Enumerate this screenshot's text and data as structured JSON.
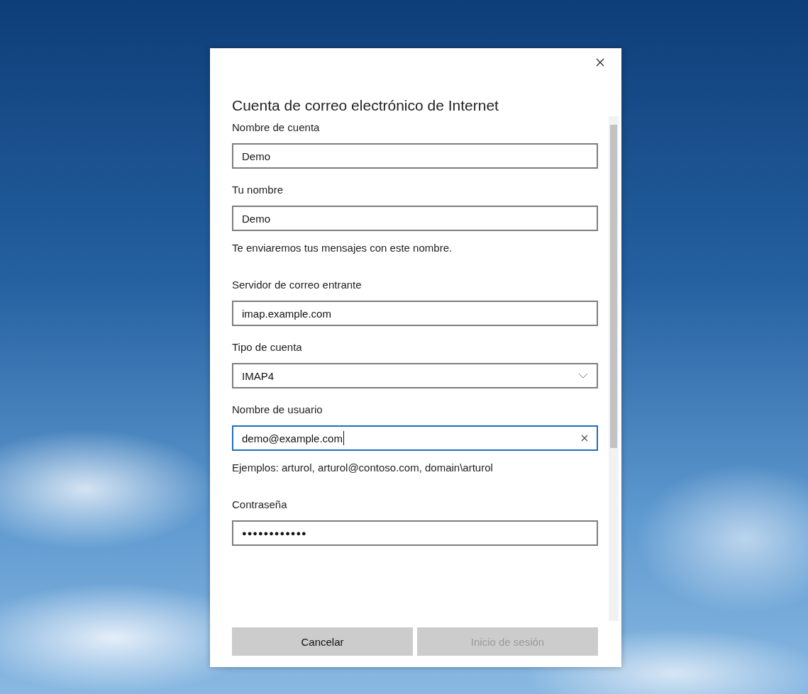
{
  "dialog": {
    "title": "Cuenta de correo electrónico de Internet",
    "fields": [
      {
        "label": "Nombre de cuenta",
        "kind": "text",
        "value": "Demo",
        "focused": false
      },
      {
        "label": "Tu nombre",
        "kind": "text",
        "value": "Demo",
        "focused": false,
        "hint": "Te enviaremos tus mensajes con este nombre."
      },
      {
        "label": "Servidor de correo entrante",
        "kind": "text",
        "value": "imap.example.com",
        "focused": false
      },
      {
        "label": "Tipo de cuenta",
        "kind": "select",
        "value": "IMAP4",
        "focused": false
      },
      {
        "label": "Nombre de usuario",
        "kind": "text",
        "value": "demo@example.com",
        "focused": true,
        "hint": "Ejemplos: arturol, arturol@contoso.com, domain\\arturol"
      },
      {
        "label": "Contraseña",
        "kind": "password",
        "value": "●●●●●●●●●●●●",
        "focused": false
      }
    ],
    "buttons": [
      {
        "label": "Cancelar",
        "disabled": false
      },
      {
        "label": "Inicio de sesión",
        "disabled": true
      }
    ]
  }
}
